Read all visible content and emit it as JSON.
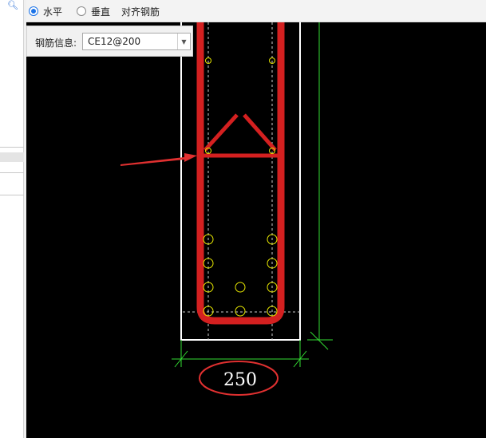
{
  "toolbar": {
    "radio_horizontal": "水平",
    "radio_vertical": "垂直",
    "align_rebar": "对齐钢筋",
    "selected": "horizontal"
  },
  "rebar_info": {
    "label": "钢筋信息:",
    "value": "CE12@200"
  },
  "drawing": {
    "dimension_value": "250"
  },
  "colors": {
    "canvas_bg": "#000000",
    "rebar": "#d42020",
    "dimension_line": "#33dd33",
    "rebar_marker": "#e6e600",
    "outline": "#ffffff",
    "annotation_arrow": "#e03030"
  },
  "icons": {
    "search": "search-icon",
    "dropdown": "chevron-down-icon"
  }
}
